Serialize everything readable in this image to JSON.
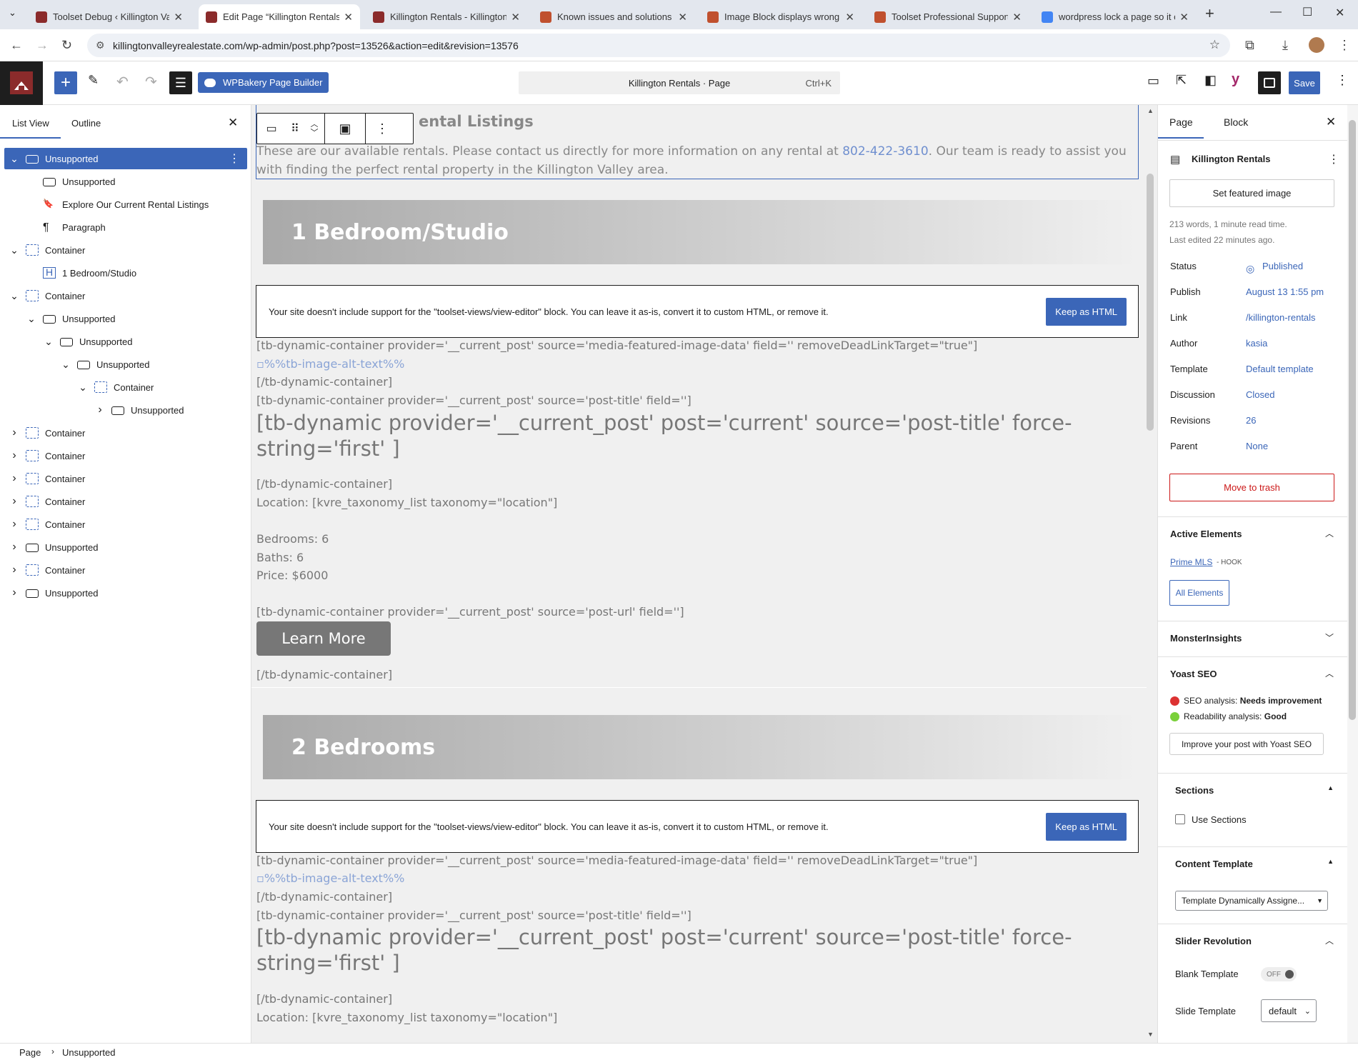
{
  "browser": {
    "tabs": [
      {
        "title": "Toolset Debug ‹ Killington Valle",
        "color": "#8b2b2b"
      },
      {
        "title": "Edit Page “Killington Rentals” ‹",
        "color": "#8b2b2b"
      },
      {
        "title": "Killington Rentals - Killington V",
        "color": "#8b2b2b"
      },
      {
        "title": "Known issues and solutions - T",
        "color": "#c0502e"
      },
      {
        "title": "Image Block displays wrong im",
        "color": "#c0502e"
      },
      {
        "title": "Toolset Professional Support -",
        "color": "#c0502e"
      },
      {
        "title": "wordpress lock a page so it ca",
        "color": "#4285f4"
      }
    ],
    "url": "killingtonvalleyrealestate.com/wp-admin/post.php?post=13526&action=edit&revision=13576"
  },
  "toolbar": {
    "wpbakery": "WPBakery Page Builder",
    "command_title": "Killington Rentals · Page",
    "command_shortcut": "Ctrl+K",
    "save": "Save"
  },
  "left_panel": {
    "tab_list": "List View",
    "tab_outline": "Outline",
    "tree": [
      {
        "label": "Unsupported",
        "depth": 0,
        "icon": "group",
        "expand": "down",
        "selected": true
      },
      {
        "label": "Unsupported",
        "depth": 1,
        "icon": "group",
        "expand": "",
        "selected": false
      },
      {
        "label": "Explore Our Current Rental Listings",
        "depth": 1,
        "icon": "bookmark",
        "expand": "",
        "selected": false
      },
      {
        "label": "Paragraph",
        "depth": 1,
        "icon": "paragraph",
        "expand": "",
        "selected": false
      },
      {
        "label": "Container",
        "depth": 0,
        "icon": "container",
        "expand": "down",
        "selected": false
      },
      {
        "label": "1 Bedroom/Studio",
        "depth": 1,
        "icon": "heading",
        "expand": "",
        "selected": false
      },
      {
        "label": "Container",
        "depth": 0,
        "icon": "container",
        "expand": "down",
        "selected": false
      },
      {
        "label": "Unsupported",
        "depth": 1,
        "icon": "group",
        "expand": "down",
        "selected": false
      },
      {
        "label": "Unsupported",
        "depth": 2,
        "icon": "group",
        "expand": "down",
        "selected": false
      },
      {
        "label": "Unsupported",
        "depth": 3,
        "icon": "group",
        "expand": "down",
        "selected": false
      },
      {
        "label": "Container",
        "depth": 4,
        "icon": "container",
        "expand": "down",
        "selected": false
      },
      {
        "label": "Unsupported",
        "depth": 5,
        "icon": "group",
        "expand": "right",
        "selected": false
      },
      {
        "label": "Container",
        "depth": 0,
        "icon": "container",
        "expand": "right",
        "selected": false
      },
      {
        "label": "Container",
        "depth": 0,
        "icon": "container",
        "expand": "right",
        "selected": false
      },
      {
        "label": "Container",
        "depth": 0,
        "icon": "container",
        "expand": "right",
        "selected": false
      },
      {
        "label": "Container",
        "depth": 0,
        "icon": "container",
        "expand": "right",
        "selected": false
      },
      {
        "label": "Container",
        "depth": 0,
        "icon": "container",
        "expand": "right",
        "selected": false
      },
      {
        "label": "Unsupported",
        "depth": 0,
        "icon": "group",
        "expand": "right",
        "selected": false
      },
      {
        "label": "Container",
        "depth": 0,
        "icon": "container",
        "expand": "right",
        "selected": false
      },
      {
        "label": "Unsupported",
        "depth": 0,
        "icon": "group",
        "expand": "right",
        "selected": false
      }
    ]
  },
  "canvas": {
    "heading_partial": "ental Listings",
    "intro_before": "These are our available rentals. Please contact us directly for more information on any rental at ",
    "phone": "802-422-3610",
    "intro_after": ". Our team is ready to assist you",
    "intro_line2": "with finding the perfect rental property in the Killington Valley area.",
    "section1": "1 Bedroom/Studio",
    "section2": "2 Bedrooms",
    "notice": "Your site doesn't include support for the \"toolset-views/view-editor\" block. You can leave it as-is, convert it to custom HTML, or remove it.",
    "keep_html": "Keep as HTML",
    "sc_image_open": "[tb-dynamic-container provider='__current_post' source='media-featured-image-data' field='' removeDeadLinkTarget=\"true\"]",
    "img_alt": "%%tb-image-alt-text%%",
    "sc_close": "[/tb-dynamic-container]",
    "sc_title_open": "[tb-dynamic-container provider='__current_post' source='post-title' field='']",
    "sc_title_big_1": "[tb-dynamic provider='__current_post' post='current' source='post-title' force-",
    "sc_title_big_2": "string='first' ]",
    "location": "Location: [kvre_taxonomy_list taxonomy=\"location\"]",
    "bedrooms": "Bedrooms: 6",
    "baths": "Baths: 6",
    "price": "Price: $6000",
    "sc_url_open": "[tb-dynamic-container provider='__current_post' source='post-url' field='']",
    "learn_more": "Learn More"
  },
  "right_panel": {
    "tab_page": "Page",
    "tab_block": "Block",
    "title": "Killington Rentals",
    "featured": "Set featured image",
    "meta1": "213 words, 1 minute read time.",
    "meta2": "Last edited 22 minutes ago.",
    "fields": [
      {
        "label": "Status",
        "value": "Published"
      },
      {
        "label": "Publish",
        "value": "August 13 1:55 pm"
      },
      {
        "label": "Link",
        "value": "/killington-rentals"
      },
      {
        "label": "Author",
        "value": "kasia"
      },
      {
        "label": "Template",
        "value": "Default template"
      },
      {
        "label": "Discussion",
        "value": "Closed"
      },
      {
        "label": "Revisions",
        "value": "26"
      },
      {
        "label": "Parent",
        "value": "None"
      }
    ],
    "trash": "Move to trash",
    "active_elements": "Active Elements",
    "prime_mls": "Prime MLS",
    "hook": "- HOOK",
    "all_elements": "All Elements",
    "monsterinsights": "MonsterInsights",
    "yoast": "Yoast SEO",
    "seo_label": "SEO analysis:",
    "seo_value": "Needs improvement",
    "read_label": "Readability analysis:",
    "read_value": "Good",
    "improve": "Improve your post with Yoast SEO",
    "sections": "Sections",
    "use_sections": "Use Sections",
    "content_template": "Content Template",
    "template_select": "Template Dynamically Assigne...",
    "slider_rev": "Slider Revolution",
    "blank_template": "Blank Template",
    "toggle_off": "OFF",
    "slide_template": "Slide Template",
    "slide_value": "default"
  },
  "breadcrumb": [
    "Page",
    "Unsupported"
  ]
}
